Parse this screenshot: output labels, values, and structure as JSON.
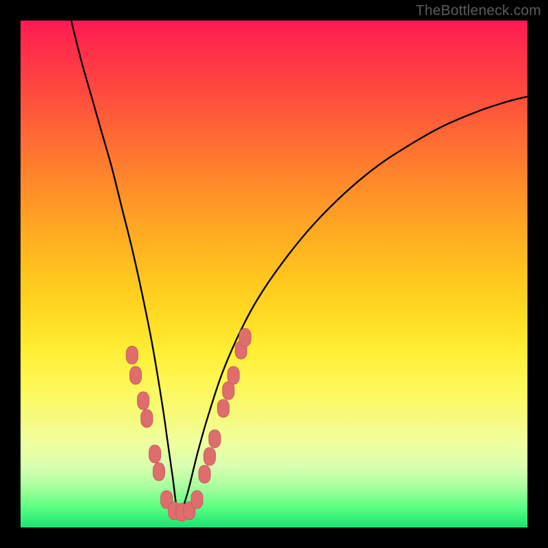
{
  "watermark": "TheBottleneck.com",
  "colors": {
    "background": "#000000",
    "curve": "#000000",
    "marker_fill": "#e06d6d",
    "marker_stroke": "#c85a5a",
    "gradient_top": "#ff1a51",
    "gradient_bottom": "#18e472"
  },
  "chart_data": {
    "type": "line",
    "title": "",
    "xlabel": "",
    "ylabel": "",
    "xlim": [
      0,
      100
    ],
    "ylim": [
      0,
      100
    ],
    "grid": false,
    "note": "No axis ticks or labels are visible. X/Y are normalized 0–100; values estimated from pixel positions. The curve is a V (dip) with minimum near x≈31, y≈3. Markers highlight points along the descent and ascent near the trough.",
    "series": [
      {
        "name": "curve",
        "x": [
          10,
          12,
          14,
          16,
          18,
          20,
          22,
          24,
          26,
          28,
          29,
          30,
          31,
          32,
          33,
          34,
          35,
          37,
          40,
          44,
          48,
          53,
          58,
          64,
          70,
          76,
          83,
          90,
          96,
          100
        ],
        "y": [
          100,
          92,
          85,
          78,
          71,
          63,
          55,
          46,
          36,
          24,
          17,
          10,
          3,
          4,
          7,
          11,
          15,
          22,
          31,
          40,
          47,
          54,
          60,
          66,
          71,
          75,
          79,
          82,
          84,
          85
        ]
      }
    ],
    "markers": {
      "name": "highlighted-points",
      "shape": "rounded",
      "points": [
        {
          "x": 22.0,
          "y": 34.0
        },
        {
          "x": 22.7,
          "y": 30.0
        },
        {
          "x": 24.2,
          "y": 25.0
        },
        {
          "x": 24.9,
          "y": 21.5
        },
        {
          "x": 26.5,
          "y": 14.5
        },
        {
          "x": 27.3,
          "y": 11.0
        },
        {
          "x": 28.8,
          "y": 5.5
        },
        {
          "x": 30.3,
          "y": 3.3
        },
        {
          "x": 31.8,
          "y": 3.0
        },
        {
          "x": 33.3,
          "y": 3.3
        },
        {
          "x": 34.8,
          "y": 5.5
        },
        {
          "x": 36.3,
          "y": 10.5
        },
        {
          "x": 37.3,
          "y": 14.0
        },
        {
          "x": 38.3,
          "y": 17.5
        },
        {
          "x": 40.0,
          "y": 23.5
        },
        {
          "x": 41.0,
          "y": 27.0
        },
        {
          "x": 42.0,
          "y": 30.0
        },
        {
          "x": 43.5,
          "y": 35.0
        },
        {
          "x": 44.3,
          "y": 37.5
        }
      ]
    }
  }
}
